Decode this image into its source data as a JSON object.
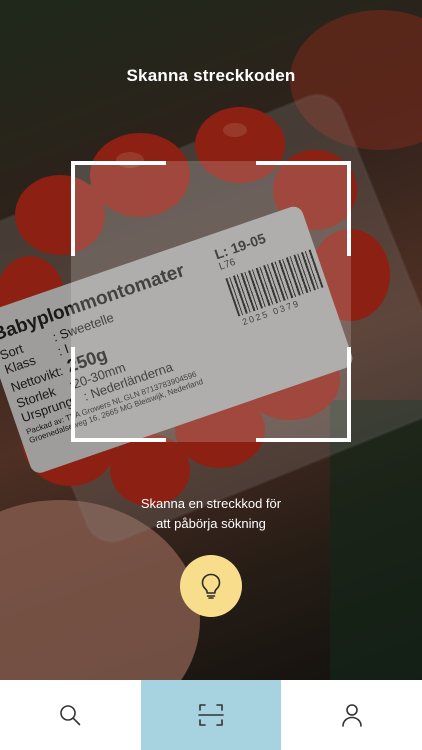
{
  "header": {
    "title": "Skanna streckkoden"
  },
  "scanner": {
    "hint_line1": "Skanna en streckkod för",
    "hint_line2": "att påbörja sökning"
  },
  "product_label": {
    "name": "Babyplommontomater",
    "sort_key": "Sort",
    "sort_val": ": Sweetelle",
    "klass_key": "Klass",
    "klass_val": ": I",
    "weight_key": "Nettovikt:",
    "weight_val": "250g",
    "size_key": "Storlek",
    "size_val": ":20-30mm",
    "origin_key": "Ursprung",
    "origin_val": ": Nederländerna",
    "packer": "Packad av: TVA Growers NL GLN 8713783904596",
    "address": "Groenedalseweg 16, 2665 MG Bleiswijk, Nederland",
    "lot": "L: 19-05",
    "lot_sub": "L76",
    "barcode_number": "2025 0379"
  },
  "flash_button": {
    "icon": "lightbulb-icon",
    "color": "#f8de8c"
  },
  "tabbar": {
    "tabs": [
      {
        "name": "search",
        "icon": "search-icon",
        "active": false
      },
      {
        "name": "scan",
        "icon": "scan-icon",
        "active": true
      },
      {
        "name": "profile",
        "icon": "user-icon",
        "active": false
      }
    ],
    "active_color": "#a7d3e1"
  }
}
